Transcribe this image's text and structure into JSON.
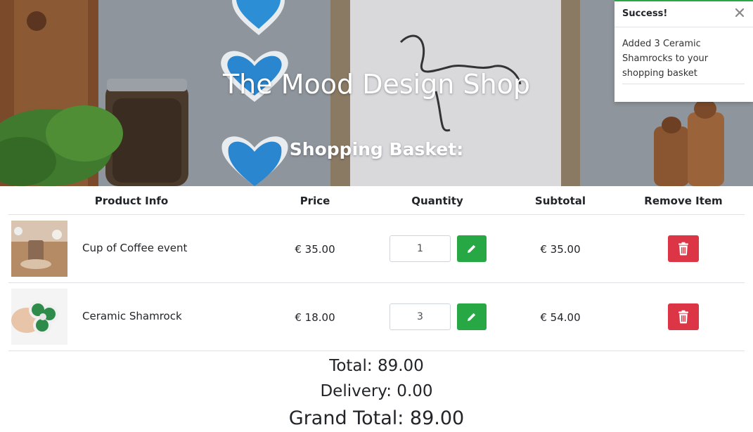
{
  "header": {
    "title": "The Mood Design Shop",
    "subtitle": "Shopping Basket:"
  },
  "toast": {
    "title": "Success!",
    "message": "Added 3 Ceramic Shamrocks to your shopping basket",
    "accent_color": "#28a745",
    "close_icon": "close-icon"
  },
  "table": {
    "headers": {
      "product": "Product Info",
      "price": "Price",
      "quantity": "Quantity",
      "subtotal": "Subtotal",
      "remove": "Remove Item"
    },
    "rows": [
      {
        "name": "Cup of Coffee event",
        "price": "€ 35.00",
        "quantity": "1",
        "subtotal": "€ 35.00"
      },
      {
        "name": "Ceramic Shamrock",
        "price": "€ 18.00",
        "quantity": "3",
        "subtotal": "€ 54.00"
      }
    ]
  },
  "totals": {
    "total": "Total: 89.00",
    "delivery": "Delivery: 0.00",
    "grand_total": "Grand Total: 89.00"
  },
  "colors": {
    "edit_button": "#28a745",
    "remove_button": "#dc3545"
  },
  "icons": {
    "edit": "pencil-icon",
    "remove": "trash-icon"
  }
}
